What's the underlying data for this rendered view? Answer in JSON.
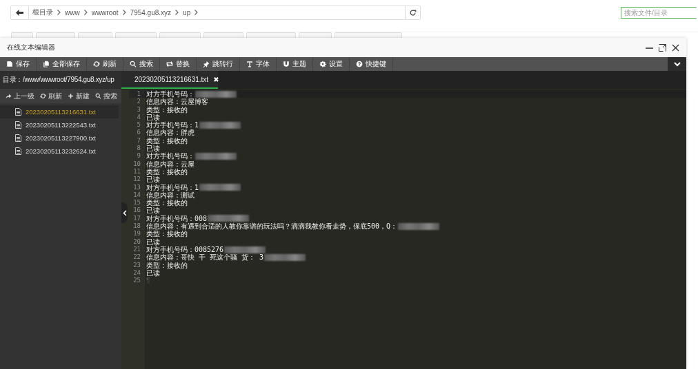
{
  "breadcrumb": {
    "items": [
      "根目录",
      "www",
      "wwwroot",
      "7954.gu8.xyz",
      "up"
    ]
  },
  "file_search": {
    "placeholder": "搜索文件/目录"
  },
  "editor": {
    "title": "在线文本编辑器",
    "toolbar": [
      {
        "label": "保存",
        "kind": "save"
      },
      {
        "label": "全部保存",
        "kind": "copy"
      },
      {
        "label": "刷新",
        "kind": "refresh"
      },
      {
        "label": "搜索",
        "kind": "search"
      },
      {
        "label": "替换",
        "kind": "replace"
      },
      {
        "label": "跳转行",
        "kind": "pin"
      },
      {
        "label": "字体",
        "kind": "font"
      },
      {
        "label": "主题",
        "kind": "magnet"
      },
      {
        "label": "设置",
        "kind": "gear"
      },
      {
        "label": "快捷键",
        "kind": "help"
      }
    ],
    "directory": "目录：/www/wwwroot/7954.gu8.xyz/up",
    "sidebar_actions": [
      {
        "label": "上一级",
        "kind": "share"
      },
      {
        "label": "刷新",
        "kind": "refresh"
      },
      {
        "label": "新建",
        "kind": "plus"
      },
      {
        "label": "搜索",
        "kind": "search"
      }
    ],
    "files": [
      {
        "name": "20230205113216631.txt",
        "selected": true
      },
      {
        "name": "20230205113222543.txt",
        "selected": false
      },
      {
        "name": "20230205113227900.txt",
        "selected": false
      },
      {
        "name": "20230205113232624.txt",
        "selected": false
      }
    ],
    "tab": {
      "name": "20230205113216631.txt",
      "close": "✖"
    },
    "lines": [
      {
        "number": "1",
        "text": "对方手机号码：",
        "redacted": true,
        "kind": "text"
      },
      {
        "number": "2",
        "text": "信息内容：云屋博客",
        "redacted": false,
        "kind": "text"
      },
      {
        "number": "3",
        "text": "类型：接收的",
        "redacted": false,
        "kind": "text"
      },
      {
        "number": "4",
        "text": "已读",
        "redacted": false,
        "kind": "text"
      },
      {
        "number": "5",
        "text": "对方手机号码：1",
        "redacted": true,
        "kind": "text"
      },
      {
        "number": "6",
        "text": "信息内容：胖虎",
        "redacted": false,
        "kind": "text"
      },
      {
        "number": "7",
        "text": "类型：接收的",
        "redacted": false,
        "kind": "text"
      },
      {
        "number": "8",
        "text": "已读",
        "redacted": false,
        "kind": "text"
      },
      {
        "number": "9",
        "text": "对方手机号码：",
        "redacted": true,
        "kind": "text"
      },
      {
        "number": "10",
        "text": "信息内容：云屋",
        "redacted": false,
        "kind": "text"
      },
      {
        "number": "11",
        "text": "类型：接收的",
        "redacted": false,
        "kind": "text"
      },
      {
        "number": "12",
        "text": "已读",
        "redacted": false,
        "kind": "text"
      },
      {
        "number": "13",
        "text": "对方手机号码：1",
        "redacted": true,
        "kind": "text"
      },
      {
        "number": "14",
        "text": "信息内容：测试",
        "redacted": false,
        "kind": "text"
      },
      {
        "number": "15",
        "text": "类型：接收的",
        "redacted": false,
        "kind": "text"
      },
      {
        "number": "16",
        "text": "已读",
        "redacted": false,
        "kind": "text"
      },
      {
        "number": "17",
        "text": "对方手机号码：008",
        "redacted": true,
        "kind": "text"
      },
      {
        "number": "18",
        "text": "信息内容：有遇到合适的人教你靠谱的玩法吗？滴滴我教你看走势，保底500，Q：",
        "redacted": true,
        "kind": "text"
      },
      {
        "number": "19",
        "text": "类型：接收的",
        "redacted": false,
        "kind": "text"
      },
      {
        "number": "20",
        "text": "已读",
        "redacted": false,
        "kind": "text"
      },
      {
        "number": "21",
        "text": "对方手机号码：0085276",
        "redacted": true,
        "kind": "text"
      },
      {
        "number": "22",
        "text": "信息内容：哥快 干 死这个骚 货： 3",
        "redacted": true,
        "kind": "text"
      },
      {
        "number": "23",
        "text": "类型：接收的",
        "redacted": false,
        "kind": "text"
      },
      {
        "number": "24",
        "text": "已读",
        "redacted": false,
        "kind": "text"
      },
      {
        "number": "25",
        "text": "¶",
        "redacted": false,
        "kind": "marker"
      }
    ]
  }
}
